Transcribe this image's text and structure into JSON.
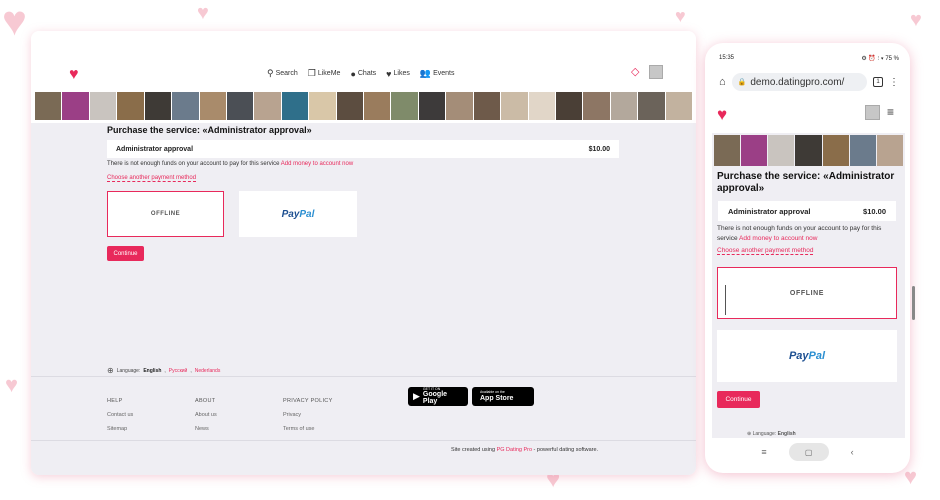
{
  "brand": {
    "accent": "#e8295b",
    "background": "#efeef3"
  },
  "desktop": {
    "nav": [
      {
        "label": "Search",
        "icon": "search-icon"
      },
      {
        "label": "LikeMe",
        "icon": "likeme-icon"
      },
      {
        "label": "Chats",
        "icon": "chat-icon"
      },
      {
        "label": "Likes",
        "icon": "heart-icon"
      },
      {
        "label": "Events",
        "icon": "people-icon"
      }
    ],
    "title": "Purchase the service:  «Administrator approval»",
    "service_name": "Administrator approval",
    "service_price": "$10.00",
    "funds_message": "There is not enough funds on your account to pay for this service",
    "add_money_link": "Add money to account now",
    "choose_other": "Choose another payment method",
    "offline_label": "OFFLINE",
    "paypal_label_1": "Pay",
    "paypal_label_2": "Pal",
    "continue_label": "Continue",
    "language_label": "Language:",
    "language_current": "English",
    "language_options": [
      "Русский",
      "Nederlands"
    ],
    "footer": {
      "help_title": "HELP",
      "help_links": [
        "Contact us",
        "Sitemap"
      ],
      "about_title": "ABOUT",
      "about_links": [
        "About us",
        "News"
      ],
      "privacy_title": "PRIVACY POLICY",
      "privacy_links": [
        "Privacy",
        "Terms of use"
      ],
      "google_play_small": "GET IT ON",
      "google_play_main": "Google Play",
      "app_store_small": "Available on the",
      "app_store_main": "App Store",
      "credit_prefix": "Site created using",
      "credit_link": "PG Dating Pro",
      "credit_suffix": " - powerful dating software."
    }
  },
  "phone": {
    "time": "15:35",
    "status_icons": "⚙ ⏰ ⫶ ▾ 75 %",
    "url": "demo.datingpro.com/",
    "tab_count": "1",
    "title": "Purchase the service:  «Administrator approval»",
    "service_name": "Administrator approval",
    "service_price": "$10.00",
    "funds_message": "There is not enough funds on your account to pay for this service",
    "add_money_link": "Add money to account now",
    "choose_other": "Choose another payment method",
    "offline_label": "OFFLINE",
    "continue_label": "Continue"
  }
}
